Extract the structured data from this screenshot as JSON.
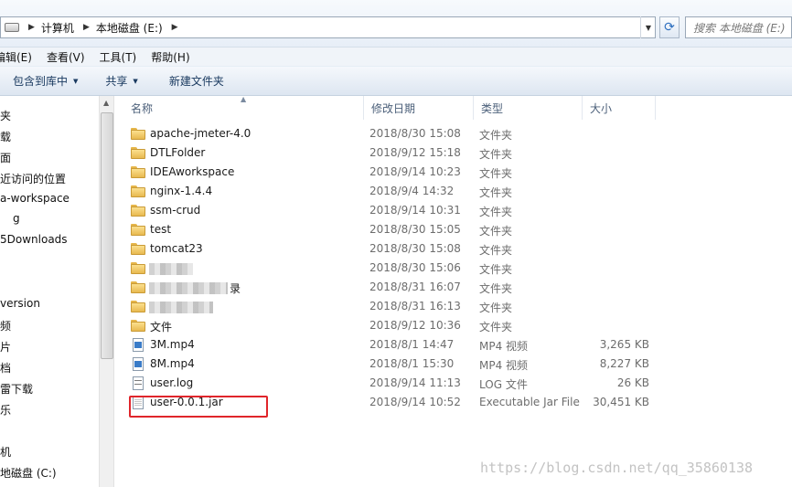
{
  "address_bar": {
    "crumbs": [
      "计算机",
      "本地磁盘 (E:)"
    ],
    "search_placeholder": "搜索 本地磁盘 (E:)"
  },
  "menu": [
    "编辑(E)",
    "查看(V)",
    "工具(T)",
    "帮助(H)"
  ],
  "toolbar": {
    "include_library": "包含到库中",
    "share": "共享",
    "new_folder": "新建文件夹"
  },
  "nav": {
    "items": [
      "夹",
      "载",
      "面",
      "近访问的位置",
      "a-workspace",
      "g",
      "5Downloads",
      "version",
      "频",
      "片",
      "档",
      "雷下载",
      "乐",
      "机",
      "地磁盘 (C:)"
    ]
  },
  "columns": {
    "name": "名称",
    "date": "修改日期",
    "type": "类型",
    "size": "大小"
  },
  "files": [
    {
      "name": "apache-jmeter-4.0",
      "date": "2018/8/30 15:08",
      "type": "文件夹",
      "size": "",
      "icon": "folder-icon"
    },
    {
      "name": "DTLFolder",
      "date": "2018/9/12 15:18",
      "type": "文件夹",
      "size": "",
      "icon": "folder-icon"
    },
    {
      "name": "IDEAworkspace",
      "date": "2018/9/14 10:23",
      "type": "文件夹",
      "size": "",
      "icon": "folder-icon"
    },
    {
      "name": "nginx-1.4.4",
      "date": "2018/9/4 14:32",
      "type": "文件夹",
      "size": "",
      "icon": "folder-icon"
    },
    {
      "name": "ssm-crud",
      "date": "2018/9/14 10:31",
      "type": "文件夹",
      "size": "",
      "icon": "folder-icon"
    },
    {
      "name": "test",
      "date": "2018/8/30 15:05",
      "type": "文件夹",
      "size": "",
      "icon": "folder-icon"
    },
    {
      "name": "tomcat23",
      "date": "2018/8/30 15:08",
      "type": "文件夹",
      "size": "",
      "icon": "folder-icon"
    },
    {
      "name": "",
      "date": "2018/8/30 15:06",
      "type": "文件夹",
      "size": "",
      "icon": "folder-icon"
    },
    {
      "name": "录",
      "date": "2018/8/31 16:07",
      "type": "文件夹",
      "size": "",
      "icon": "folder-icon"
    },
    {
      "name": "",
      "date": "2018/8/31 16:13",
      "type": "文件夹",
      "size": "",
      "icon": "folder-icon"
    },
    {
      "name": "文件",
      "date": "2018/9/12 10:36",
      "type": "文件夹",
      "size": "",
      "icon": "folder-icon"
    },
    {
      "name": "3M.mp4",
      "date": "2018/8/1 14:47",
      "type": "MP4 视频",
      "size": "3,265 KB",
      "icon": "video-file-icon"
    },
    {
      "name": "8M.mp4",
      "date": "2018/8/1 15:30",
      "type": "MP4 视频",
      "size": "8,227 KB",
      "icon": "video-file-icon"
    },
    {
      "name": "user.log",
      "date": "2018/9/14 11:13",
      "type": "LOG 文件",
      "size": "26 KB",
      "icon": "log-file-icon"
    },
    {
      "name": "user-0.0.1.jar",
      "date": "2018/9/14 10:52",
      "type": "Executable Jar File",
      "size": "30,451 KB",
      "icon": "jar-file-icon"
    }
  ],
  "watermark": "https://blog.csdn.net/qq_35860138",
  "colors": {
    "highlight": "#e0252b",
    "folder": "#e8b94f"
  }
}
